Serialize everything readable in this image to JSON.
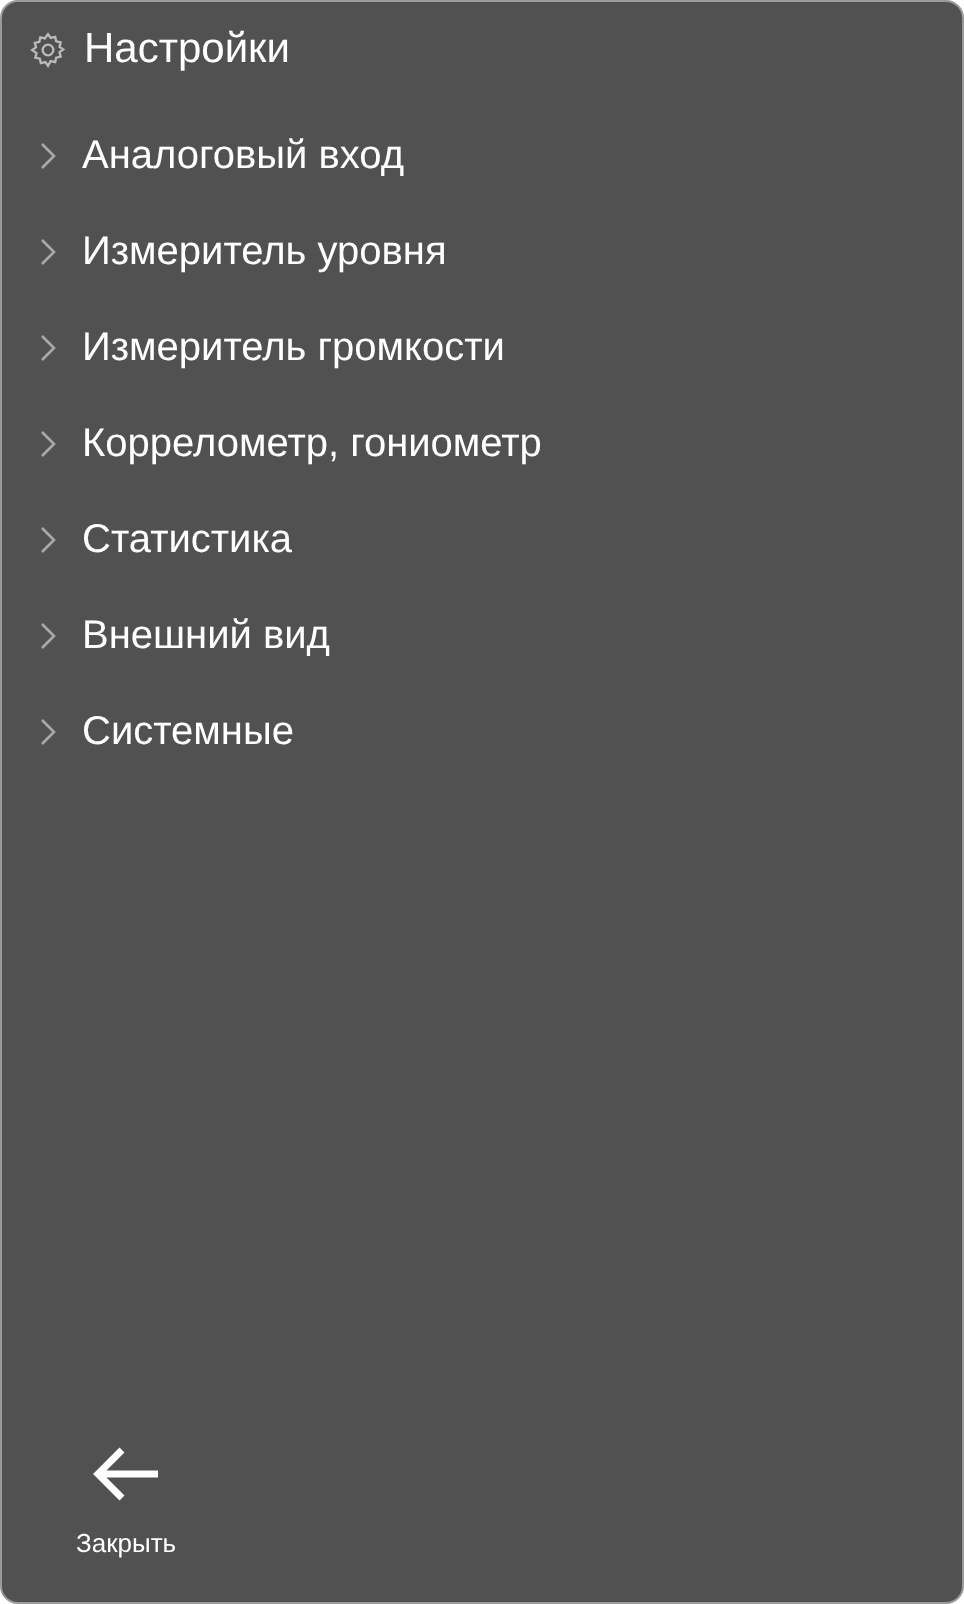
{
  "header": {
    "title": "Настройки"
  },
  "items": [
    {
      "label": "Аналоговый вход"
    },
    {
      "label": "Измеритель уровня"
    },
    {
      "label": "Измеритель громкости"
    },
    {
      "label": "Коррелометр, гониометр"
    },
    {
      "label": "Статистика"
    },
    {
      "label": "Внешний вид"
    },
    {
      "label": "Системные"
    }
  ],
  "close_button": {
    "label": "Закрыть"
  }
}
